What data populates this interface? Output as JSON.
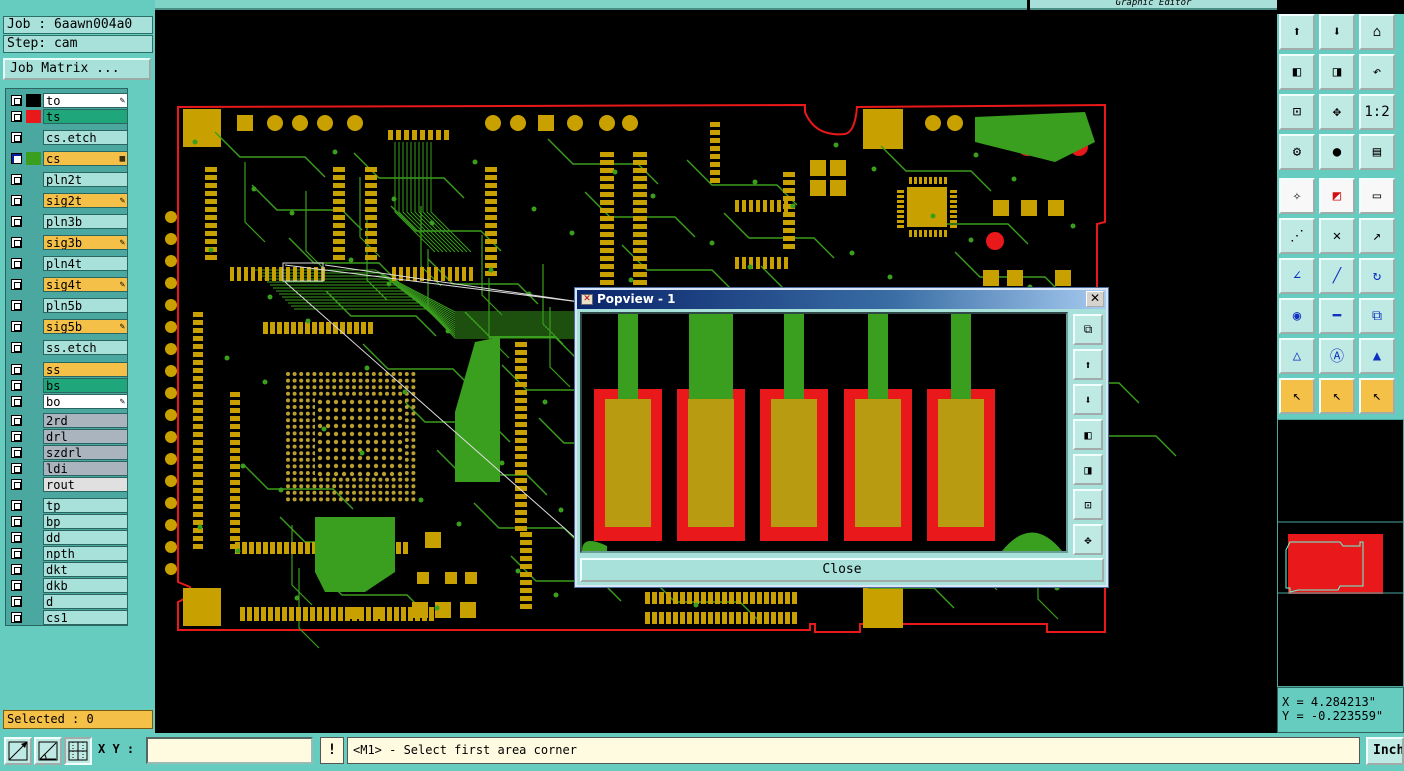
{
  "header": {
    "graphic_editor_title": "Graphic Editor"
  },
  "job": {
    "job_label": "Job : 6aawn004a0",
    "step_label": "Step: cam",
    "matrix_button": "Job Matrix ..."
  },
  "layers": {
    "group1": [
      {
        "name": "to",
        "color": "#ffffff",
        "swatch": "#000000",
        "checked": false,
        "editable": true
      },
      {
        "name": "ts",
        "color": "#1fa67a",
        "swatch": "#e8181b",
        "checked": false,
        "editable": false
      }
    ],
    "group2": [
      {
        "name": "cs.etch",
        "color": "#a8e0da",
        "swatch": "",
        "checked": false,
        "editable": false
      },
      {
        "name": "cs",
        "color": "#f5c048",
        "swatch": "#3a9e1e",
        "checked": true,
        "editable": true
      },
      {
        "name": "pln2t",
        "color": "#a8e0da",
        "swatch": "",
        "checked": false,
        "editable": false
      },
      {
        "name": "sig2t",
        "color": "#f5c048",
        "swatch": "",
        "checked": false,
        "editable": true
      },
      {
        "name": "pln3b",
        "color": "#a8e0da",
        "swatch": "",
        "checked": false,
        "editable": false
      },
      {
        "name": "sig3b",
        "color": "#f5c048",
        "swatch": "",
        "checked": false,
        "editable": true
      },
      {
        "name": "pln4t",
        "color": "#a8e0da",
        "swatch": "",
        "checked": false,
        "editable": false
      },
      {
        "name": "sig4t",
        "color": "#f5c048",
        "swatch": "",
        "checked": false,
        "editable": true
      },
      {
        "name": "pln5b",
        "color": "#a8e0da",
        "swatch": "",
        "checked": false,
        "editable": false
      },
      {
        "name": "sig5b",
        "color": "#f5c048",
        "swatch": "",
        "checked": false,
        "editable": true
      },
      {
        "name": "ss.etch",
        "color": "#a8e0da",
        "swatch": "",
        "checked": false,
        "editable": false
      }
    ],
    "group3": [
      {
        "name": "ss",
        "color": "#f5c048",
        "swatch": "",
        "checked": false,
        "editable": false
      },
      {
        "name": "bs",
        "color": "#1fa67a",
        "swatch": "",
        "checked": false,
        "editable": false
      },
      {
        "name": "bo",
        "color": "#ffffff",
        "swatch": "",
        "checked": false,
        "editable": true
      }
    ],
    "group4": [
      {
        "name": "2rd",
        "color": "#a9b4bf",
        "swatch": "",
        "checked": false,
        "editable": false
      },
      {
        "name": "drl",
        "color": "#a9b4bf",
        "swatch": "",
        "checked": false,
        "editable": false
      },
      {
        "name": "szdrl",
        "color": "#a9b4bf",
        "swatch": "",
        "checked": false,
        "editable": false
      },
      {
        "name": "ldi",
        "color": "#a9b4bf",
        "swatch": "",
        "checked": false,
        "editable": false
      },
      {
        "name": "rout",
        "color": "#e0e0e0",
        "swatch": "",
        "checked": false,
        "editable": false
      }
    ],
    "group5": [
      {
        "name": "tp",
        "color": "#a8e0da",
        "swatch": "",
        "checked": false,
        "editable": false
      },
      {
        "name": "bp",
        "color": "#a8e0da",
        "swatch": "",
        "checked": false,
        "editable": false
      },
      {
        "name": "dd",
        "color": "#a8e0da",
        "swatch": "",
        "checked": false,
        "editable": false
      },
      {
        "name": "npth",
        "color": "#a8e0da",
        "swatch": "",
        "checked": false,
        "editable": false
      },
      {
        "name": "dkt",
        "color": "#a8e0da",
        "swatch": "",
        "checked": false,
        "editable": false
      },
      {
        "name": "dkb",
        "color": "#a8e0da",
        "swatch": "",
        "checked": false,
        "editable": false
      },
      {
        "name": "d",
        "color": "#a8e0da",
        "swatch": "",
        "checked": false,
        "editable": false
      },
      {
        "name": "cs1",
        "color": "#a8e0da",
        "swatch": "",
        "checked": false,
        "editable": false
      }
    ]
  },
  "selected": {
    "label": "Selected : 0"
  },
  "popview": {
    "title": "Popview - 1",
    "close_label": "Close"
  },
  "coords": {
    "x": "X = 4.284213\"",
    "y": "Y = -0.223559\""
  },
  "bottom": {
    "xy_label": "X Y :",
    "xy_value": "",
    "bang": "!",
    "status": "<M1> - Select first area corner",
    "units": "Inch"
  },
  "colors": {
    "copper": "#c8a000",
    "trace": "#3a9e1e",
    "mask": "#e8181b",
    "board_outline": "#e8181b",
    "panel": "#66ccc0"
  },
  "tool_icons": [
    "zoom-home-icon",
    "zoom-window-icon",
    "zoom-house-icon",
    "pan-left-icon",
    "pan-right-icon",
    "undo-view-icon",
    "fit-icon",
    "center-icon",
    "one-to-two-icon",
    "settings-icon",
    "measure-point-icon",
    "layer-toggle-icon",
    "snap-icon",
    "line-icon",
    "ruler-icon",
    "nodes-icon",
    "cross-icon",
    "arrow-icon",
    "angle-icon",
    "line-diagonal-icon",
    "rotate-icon",
    "feature-icon",
    "minus-icon",
    "zoom-fit-icon",
    "triangle-icon",
    "triangle-a-icon",
    "triangle-outline-icon",
    "pointer-icon",
    "pointer-box-icon",
    "pointer-select-icon"
  ]
}
